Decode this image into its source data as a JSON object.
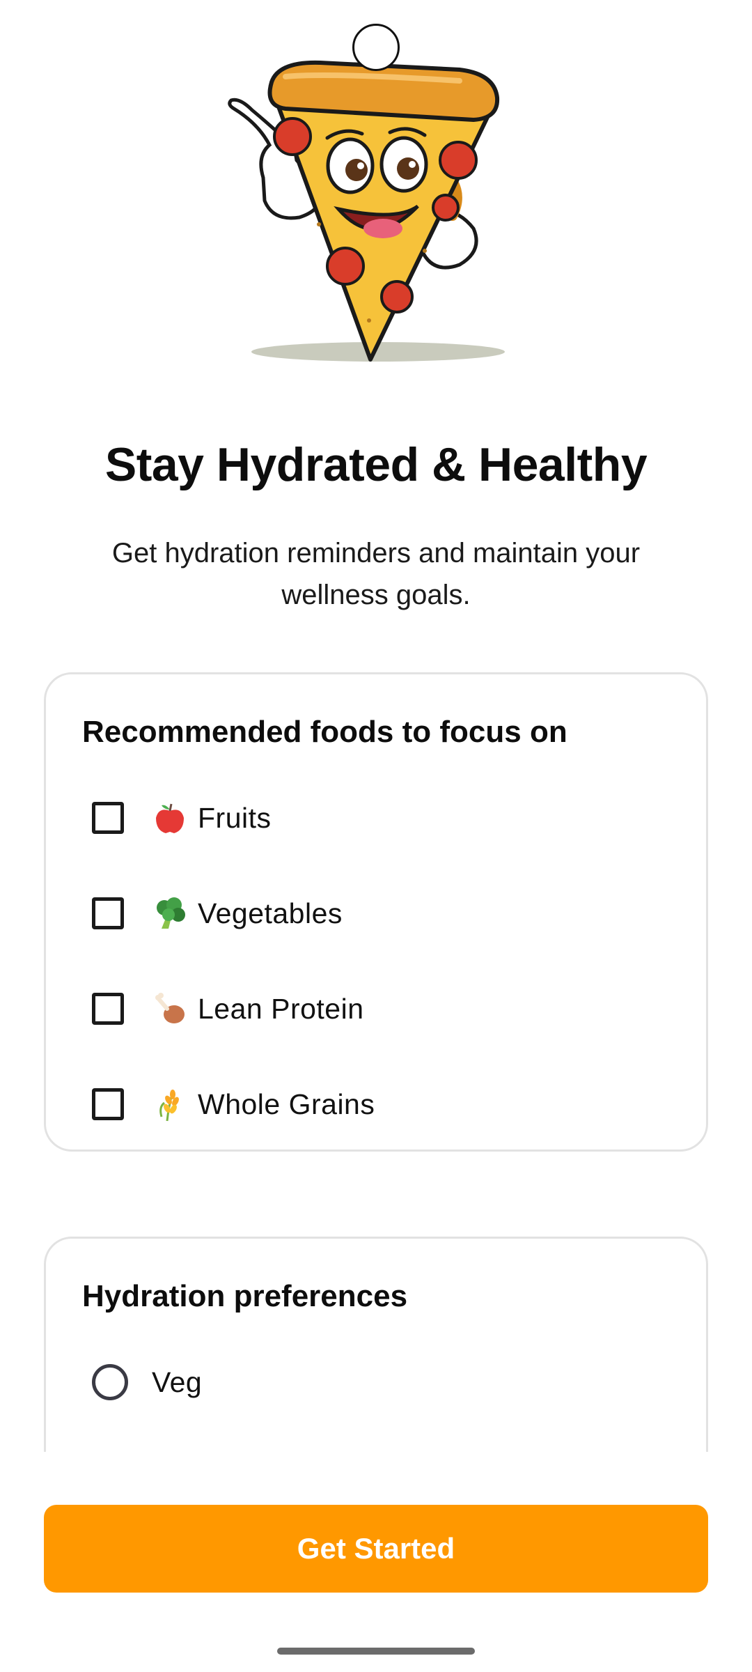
{
  "hero": {
    "mascot_icon": "pizza-slice-mascot",
    "title": "Stay Hydrated & Healthy",
    "subtitle": "Get hydration reminders and maintain your wellness goals."
  },
  "foods_card": {
    "title": "Recommended foods to focus on",
    "options": [
      {
        "label": "Fruits",
        "icon": "apple-icon",
        "checked": false
      },
      {
        "label": "Vegetables",
        "icon": "broccoli-icon",
        "checked": false
      },
      {
        "label": "Lean Protein",
        "icon": "poultry-leg-icon",
        "checked": false
      },
      {
        "label": "Whole Grains",
        "icon": "wheat-icon",
        "checked": false
      }
    ]
  },
  "hydration_card": {
    "title": "Hydration preferences",
    "options": [
      {
        "label": "Veg",
        "selected": false
      }
    ]
  },
  "cta": {
    "label": "Get Started",
    "color": "#ff9800"
  }
}
